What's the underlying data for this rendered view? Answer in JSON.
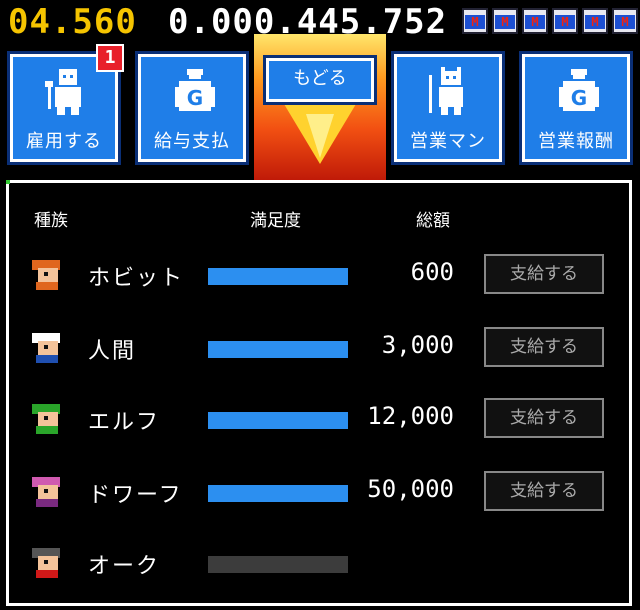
{
  "top": {
    "timer": "04.560",
    "money": "0.000.445.752",
    "cans": [
      "M",
      "M",
      "M",
      "M",
      "M",
      "M"
    ]
  },
  "nav": {
    "hire": {
      "label": "雇用する",
      "badge": "1"
    },
    "salary": {
      "label": "給与支払"
    },
    "back": {
      "label": "もどる"
    },
    "salesman": {
      "label": "営業マン"
    },
    "sales_reward": {
      "label": "営業報酬"
    }
  },
  "table": {
    "headers": {
      "race": "種族",
      "satisfaction": "満足度",
      "total": "総額"
    },
    "rows": [
      {
        "name": "ホビット",
        "satisfaction": 1.0,
        "amount": "600",
        "pay_label": "支給する",
        "hair": "#e0661e",
        "clothes": "#e0661e"
      },
      {
        "name": "人間",
        "satisfaction": 1.0,
        "amount": "3,000",
        "pay_label": "支給する",
        "hair": "#ffffff",
        "clothes": "#1f4fb0"
      },
      {
        "name": "エルフ",
        "satisfaction": 1.0,
        "amount": "12,000",
        "pay_label": "支給する",
        "hair": "#2aa52a",
        "clothes": "#2aa52a"
      },
      {
        "name": "ドワーフ",
        "satisfaction": 1.0,
        "amount": "50,000",
        "pay_label": "支給する",
        "hair": "#d05ab0",
        "clothes": "#7a2a80"
      },
      {
        "name": "オーク",
        "satisfaction": 0.0,
        "amount": "",
        "pay_label": "",
        "hair": "#555555",
        "clothes": "#d01818"
      }
    ]
  },
  "colors": {
    "accent": "#1f7ee8",
    "bar": "#2c8ff0",
    "timer": "#f5c400"
  }
}
